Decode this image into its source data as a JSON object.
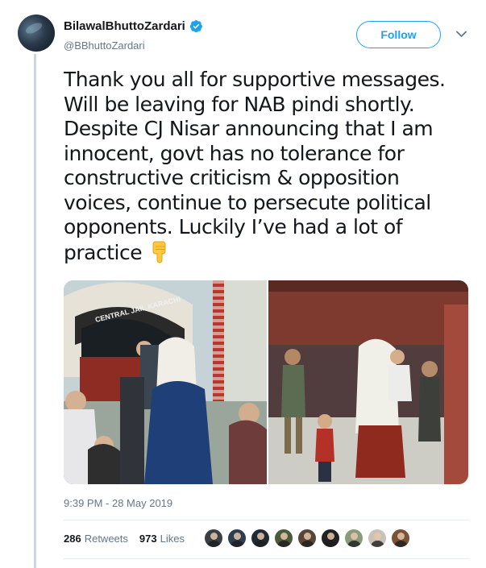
{
  "author": {
    "display_name": "BilawalBhuttoZardari",
    "handle": "@BBhuttoZardari",
    "verified": true,
    "avatar_icon": "profile-photo"
  },
  "header": {
    "follow_label": "Follow",
    "menu_icon": "chevron-down-icon"
  },
  "tweet": {
    "lines": [
      "Thank you all for supportive messages.",
      "Will be leaving for NAB pindi shortly.",
      "Despite CJ Nisar announcing that I am",
      "innocent, govt has no tolerance for",
      "constructive criticism & opposition",
      "voices, continue to persecute political",
      "opponents. Luckily I’ve had a lot of",
      "practice"
    ],
    "trailing_emoji": "backhand-index-pointing-down-icon"
  },
  "media": {
    "photos": [
      {
        "sign_text": "CENTRAL JAIL KARACHI"
      },
      {
        "sign_text": ""
      }
    ]
  },
  "meta": {
    "timestamp": "9:39 PM - 28 May 2019"
  },
  "stats": {
    "retweets_count": "286",
    "retweets_label": "Retweets",
    "likes_count": "973",
    "likes_label": "Likes"
  },
  "likers": [
    {
      "color": "#3a3f45"
    },
    {
      "color": "#2c3e50"
    },
    {
      "color": "#1f2a36"
    },
    {
      "color": "#4a5a3a"
    },
    {
      "color": "#5a4636"
    },
    {
      "color": "#222222"
    },
    {
      "color": "#8a9a7a"
    },
    {
      "color": "#c9c2b8"
    },
    {
      "color": "#7a5236"
    }
  ],
  "colors": {
    "accent": "#1da1f2",
    "text_primary": "#14171a",
    "text_secondary": "#657786",
    "thread_line": "#ccd6dd"
  }
}
